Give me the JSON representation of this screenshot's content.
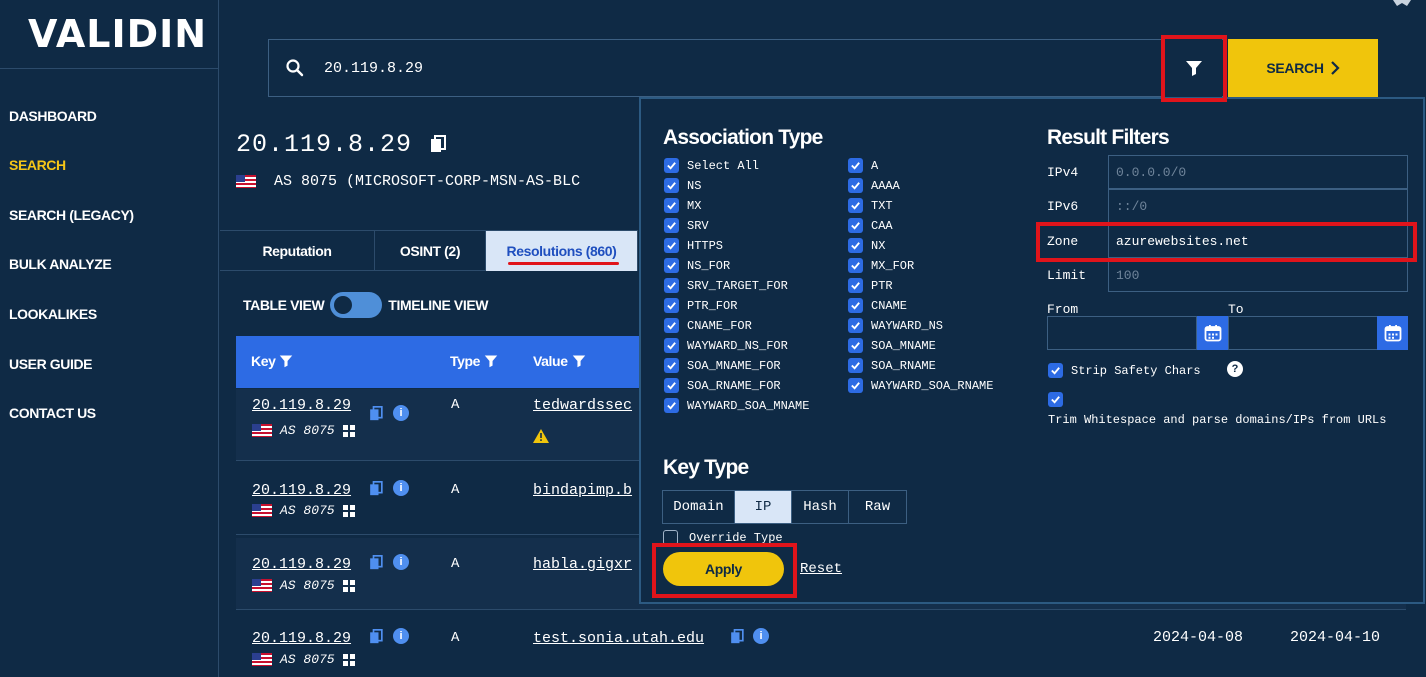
{
  "logo": "VALIDIN",
  "sidebar": {
    "items": [
      {
        "label": "DASHBOARD"
      },
      {
        "label": "SEARCH",
        "active": true
      },
      {
        "label": "SEARCH (LEGACY)"
      },
      {
        "label": "BULK ANALYZE"
      },
      {
        "label": "LOOKALIKES"
      },
      {
        "label": "USER GUIDE"
      },
      {
        "label": "CONTACT US"
      }
    ]
  },
  "search": {
    "value": "20.119.8.29",
    "button_label": "SEARCH"
  },
  "result": {
    "ip": "20.119.8.29",
    "as": "AS 8075 (MICROSOFT-CORP-MSN-AS-BLC"
  },
  "tabs": [
    {
      "label": "Reputation"
    },
    {
      "label": "OSINT (2)"
    },
    {
      "label": "Resolutions (860)",
      "active": true
    }
  ],
  "view_toggle": {
    "left": "TABLE VIEW",
    "right": "TIMELINE VIEW"
  },
  "table": {
    "headers": {
      "key": "Key",
      "type": "Type",
      "value": "Value"
    },
    "rows": [
      {
        "ip": "20.119.8.29",
        "as": "AS 8075",
        "type": "A",
        "value": "tedwardssec",
        "warning": true
      },
      {
        "ip": "20.119.8.29",
        "as": "AS 8075",
        "type": "A",
        "value": "bindapimp.b"
      },
      {
        "ip": "20.119.8.29",
        "as": "AS 8075",
        "type": "A",
        "value": "habla.gigxr"
      },
      {
        "ip": "20.119.8.29",
        "as": "AS 8075",
        "type": "A",
        "value": "test.sonia.utah.edu",
        "first_seen": "2024-04-08",
        "last_seen": "2024-04-10"
      }
    ]
  },
  "filter_panel": {
    "association_type": {
      "title": "Association Type",
      "col1": [
        "Select All",
        "NS",
        "MX",
        "SRV",
        "HTTPS",
        "NS_FOR",
        "SRV_TARGET_FOR",
        "PTR_FOR",
        "CNAME_FOR",
        "WAYWARD_NS_FOR",
        "SOA_MNAME_FOR",
        "SOA_RNAME_FOR",
        "WAYWARD_SOA_MNAME"
      ],
      "col2": [
        "A",
        "AAAA",
        "TXT",
        "CAA",
        "NX",
        "MX_FOR",
        "PTR",
        "CNAME",
        "WAYWARD_NS",
        "SOA_MNAME",
        "SOA_RNAME",
        "WAYWARD_SOA_RNAME"
      ]
    },
    "result_filters": {
      "title": "Result Filters",
      "ipv4": {
        "label": "IPv4",
        "placeholder": "0.0.0.0/0"
      },
      "ipv6": {
        "label": "IPv6",
        "placeholder": "::/0"
      },
      "zone": {
        "label": "Zone",
        "value": "azurewebsites.net"
      },
      "limit": {
        "label": "Limit",
        "placeholder": "100"
      },
      "from_label": "From",
      "to_label": "To",
      "strip_safety": "Strip Safety Chars",
      "trim_whitespace": "Trim Whitespace and parse domains/IPs from URLs"
    },
    "key_type": {
      "title": "Key Type",
      "options": [
        "Domain",
        "IP",
        "Hash",
        "Raw"
      ],
      "selected": "IP",
      "override": "Override Type"
    },
    "apply_label": "Apply",
    "reset_label": "Reset"
  },
  "colors": {
    "accent": "#f0c50c",
    "background": "#0f2a45",
    "primary": "#2d6be4",
    "highlight": "#e0141b"
  }
}
